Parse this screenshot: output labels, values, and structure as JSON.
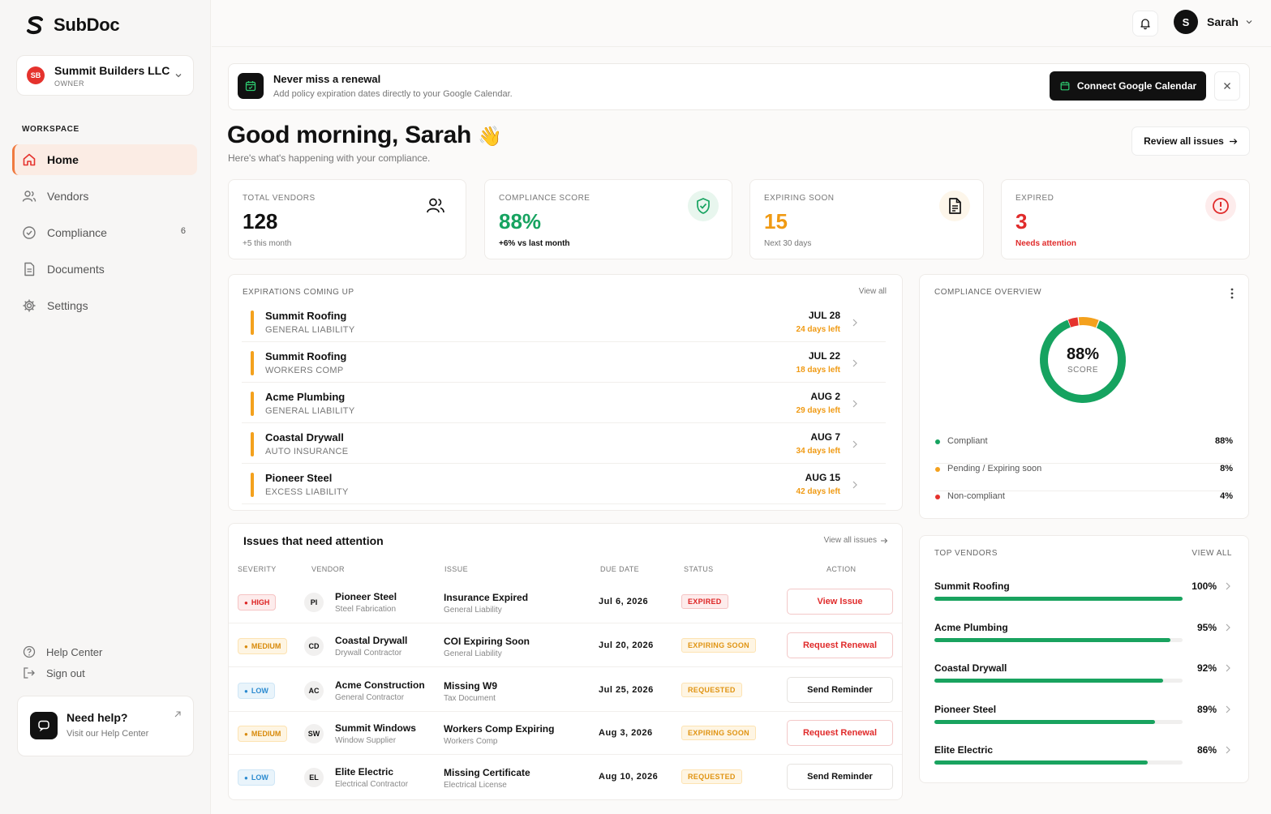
{
  "app": {
    "name": "SubDoc"
  },
  "org": {
    "initials": "SB",
    "name": "Summit Builders LLC",
    "role": "OWNER"
  },
  "sidebar": {
    "section_label": "WORKSPACE",
    "items": [
      {
        "label": "Home",
        "icon": "home-icon"
      },
      {
        "label": "Vendors",
        "icon": "users-icon"
      },
      {
        "label": "Compliance",
        "icon": "check-circle-icon",
        "badge": "6"
      },
      {
        "label": "Documents",
        "icon": "document-icon"
      },
      {
        "label": "Settings",
        "icon": "gear-icon"
      }
    ],
    "help_center": "Help Center",
    "sign_out": "Sign out",
    "help_card": {
      "title": "Need help?",
      "subtitle": "Visit our Help Center"
    }
  },
  "header": {
    "user_initial": "S",
    "user_name": "Sarah"
  },
  "banner": {
    "title": "Never miss a renewal",
    "subtitle": "Add policy expiration dates directly to your Google Calendar.",
    "button": "Connect Google Calendar"
  },
  "greeting": {
    "title": "Good morning, Sarah",
    "emoji": "👋",
    "subtitle": "Here's what's happening with your compliance.",
    "review_button": "Review all issues"
  },
  "stats": [
    {
      "label": "TOTAL VENDORS",
      "value": "128",
      "sub": "+5 this month",
      "color": "#111111"
    },
    {
      "label": "COMPLIANCE SCORE",
      "value": "88%",
      "sub": "+6% vs last month",
      "color": "#16a360"
    },
    {
      "label": "EXPIRING SOON",
      "value": "15",
      "sub": "Next 30 days",
      "color": "#f09a13"
    },
    {
      "label": "EXPIRED",
      "value": "3",
      "sub": "Needs attention",
      "color": "#e02b2b"
    }
  ],
  "expirations": {
    "title": "EXPIRATIONS COMING UP",
    "view_all": "View all",
    "items": [
      {
        "vendor": "Summit Roofing",
        "type": "GENERAL LIABILITY",
        "date": "JUL 28",
        "days": "24 days left"
      },
      {
        "vendor": "Summit Roofing",
        "type": "WORKERS COMP",
        "date": "JUL 22",
        "days": "18 days left"
      },
      {
        "vendor": "Acme Plumbing",
        "type": "GENERAL LIABILITY",
        "date": "AUG 2",
        "days": "29 days left"
      },
      {
        "vendor": "Coastal Drywall",
        "type": "AUTO INSURANCE",
        "date": "AUG 7",
        "days": "34 days left"
      },
      {
        "vendor": "Pioneer Steel",
        "type": "EXCESS LIABILITY",
        "date": "AUG 15",
        "days": "42 days left"
      }
    ]
  },
  "overview": {
    "title": "COMPLIANCE OVERVIEW",
    "score": "88%",
    "score_label": "SCORE",
    "legend": [
      {
        "name": "Compliant",
        "value": "88%",
        "color": "#16a360",
        "pct": 88
      },
      {
        "name": "Pending / Expiring soon",
        "value": "8%",
        "color": "#f4a11d",
        "pct": 8
      },
      {
        "name": "Non-compliant",
        "value": "4%",
        "color": "#e5322d",
        "pct": 4
      }
    ]
  },
  "issues": {
    "title": "Issues that need attention",
    "view_all": "View all issues",
    "columns": [
      "SEVERITY",
      "VENDOR",
      "ISSUE",
      "DUE DATE",
      "STATUS",
      "ACTION"
    ],
    "rows": [
      {
        "severity": "HIGH",
        "sev_class": "high",
        "initials": "PI",
        "vendor": "Pioneer Steel",
        "vendor_sub": "Steel Fabrication",
        "issue": "Insurance Expired",
        "issue_sub": "General Liability",
        "due": "Jul 6, 2026",
        "status": "EXPIRED",
        "status_class": "expired",
        "action": "View Issue",
        "action_red": true
      },
      {
        "severity": "MEDIUM",
        "sev_class": "medium",
        "initials": "CD",
        "vendor": "Coastal Drywall",
        "vendor_sub": "Drywall Contractor",
        "issue": "COI Expiring Soon",
        "issue_sub": "General Liability",
        "due": "Jul 20, 2026",
        "status": "EXPIRING SOON",
        "status_class": "soon",
        "action": "Request Renewal",
        "action_red": true
      },
      {
        "severity": "LOW",
        "sev_class": "low",
        "initials": "AC",
        "vendor": "Acme Construction",
        "vendor_sub": "General Contractor",
        "issue": "Missing W9",
        "issue_sub": "Tax Document",
        "due": "Jul 25, 2026",
        "status": "REQUESTED",
        "status_class": "req",
        "action": "Send Reminder",
        "action_red": false
      },
      {
        "severity": "MEDIUM",
        "sev_class": "medium",
        "initials": "SW",
        "vendor": "Summit Windows",
        "vendor_sub": "Window Supplier",
        "issue": "Workers Comp Expiring",
        "issue_sub": "Workers Comp",
        "due": "Aug 3, 2026",
        "status": "EXPIRING SOON",
        "status_class": "soon",
        "action": "Request Renewal",
        "action_red": true
      },
      {
        "severity": "LOW",
        "sev_class": "low",
        "initials": "EL",
        "vendor": "Elite Electric",
        "vendor_sub": "Electrical Contractor",
        "issue": "Missing Certificate",
        "issue_sub": "Electrical License",
        "due": "Aug 10, 2026",
        "status": "REQUESTED",
        "status_class": "req",
        "action": "Send Reminder",
        "action_red": false
      }
    ]
  },
  "top_vendors": {
    "title": "TOP VENDORS",
    "view_all": "VIEW ALL",
    "items": [
      {
        "name": "Summit Roofing",
        "value": "100%",
        "pct": 100
      },
      {
        "name": "Acme Plumbing",
        "value": "95%",
        "pct": 95
      },
      {
        "name": "Coastal Drywall",
        "value": "92%",
        "pct": 92
      },
      {
        "name": "Pioneer Steel",
        "value": "89%",
        "pct": 89
      },
      {
        "name": "Elite Electric",
        "value": "86%",
        "pct": 86
      }
    ]
  }
}
